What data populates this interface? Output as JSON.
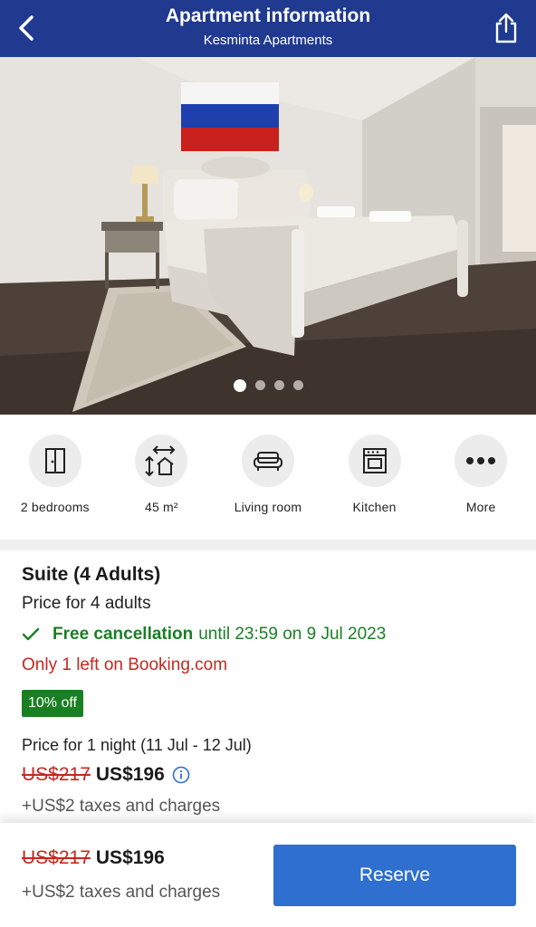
{
  "header": {
    "title": "Apartment information",
    "subtitle": "Kesminta Apartments",
    "bg_color": "#1f3a8f"
  },
  "gallery": {
    "image_count": 4,
    "active_index": 0
  },
  "facilities": [
    {
      "label": "2 bedrooms",
      "icon": "door-icon"
    },
    {
      "label": "45 m²",
      "icon": "room-size-icon"
    },
    {
      "label": "Living room",
      "icon": "sofa-icon"
    },
    {
      "label": "Kitchen",
      "icon": "oven-icon"
    },
    {
      "label": "More",
      "icon": "more-icon"
    }
  ],
  "room": {
    "name": "Suite (4 Adults)",
    "price_for": "Price for 4 adults",
    "cancellation_bold": "Free cancellation",
    "cancellation_rest": "until 23:59 on 9 Jul 2023",
    "availability": "Only 1 left on Booking.com",
    "discount_badge": "10% off",
    "night_info": "Price for 1 night (11 Jul - 12 Jul)",
    "old_price": "US$217",
    "new_price": "US$196",
    "taxes": "+US$2 taxes and charges"
  },
  "footer": {
    "old_price": "US$217",
    "new_price": "US$196",
    "taxes": "+US$2 taxes and charges",
    "reserve_label": "Reserve"
  },
  "colors": {
    "header": "#1f3a8f",
    "accent_green": "#1a7f23",
    "accent_red": "#c3281f",
    "button_blue": "#2e6fcf"
  }
}
